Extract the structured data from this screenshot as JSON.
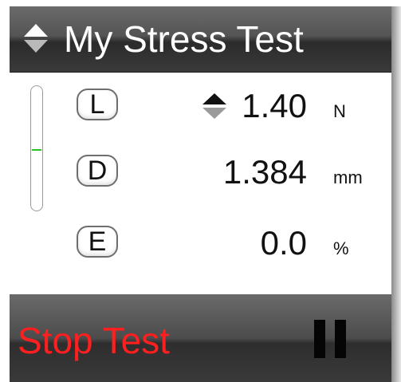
{
  "header": {
    "title": "My Stress Test",
    "sort_icon": "sort-up-down-icon"
  },
  "gauge": {
    "level": 0.49,
    "color": "#22c322"
  },
  "rows": [
    {
      "key": "L",
      "value": "1.40",
      "unit": "N",
      "sort_icon": "sort-up-down-icon"
    },
    {
      "key": "D",
      "value": "1.384",
      "unit": "mm"
    },
    {
      "key": "E",
      "value": "0.0",
      "unit": "%"
    }
  ],
  "footer": {
    "stop_label": "Stop Test",
    "stop_color": "#ff1f1f",
    "pause_icon": "pause-icon"
  },
  "colors": {
    "header_text": "#ffffff",
    "value_text": "#111111"
  }
}
